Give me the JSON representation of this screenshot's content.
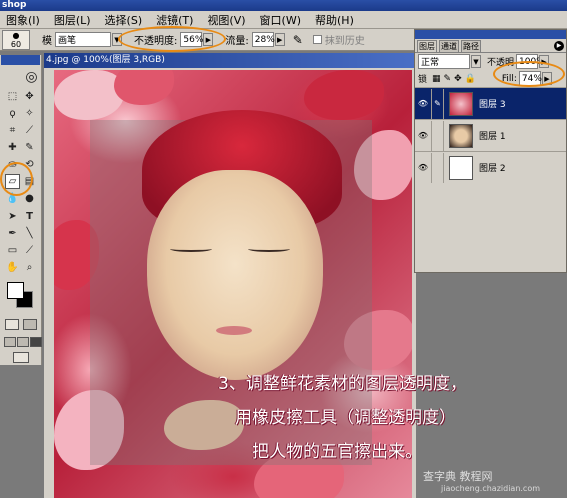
{
  "app": {
    "title": "shop"
  },
  "menu": [
    "图象(I)",
    "图层(L)",
    "选择(S)",
    "滤镜(T)",
    "视图(V)",
    "窗口(W)",
    "帮助(H)"
  ],
  "options": {
    "preset_size": "60",
    "mode_label": "模",
    "mode_value": "画笔",
    "opacity_label": "不透明度:",
    "opacity_value": "56%",
    "flow_label": "流量:",
    "flow_value": "28%",
    "erase_history_label": "抹到历史"
  },
  "document": {
    "title": "4.jpg @ 100%(图层 3,RGB)",
    "caption_lines": [
      "3、调整鲜花素材的图层透明度，",
      "用橡皮擦工具（调整透明度）",
      "把人物的五官擦出来。"
    ],
    "watermark": "查字典 教程网",
    "watermark_url": "jiaocheng.chazidian.com"
  },
  "layers_palette": {
    "tabs": [
      "图层",
      "通道",
      "路径"
    ],
    "blend_mode": "正常",
    "opacity_label": "不透明",
    "opacity_value": "100%",
    "lock_label": "锁",
    "fill_label": "Fill:",
    "fill_value": "74%",
    "layers": [
      {
        "name": "图层 3",
        "selected": true
      },
      {
        "name": "图层 1",
        "selected": false
      },
      {
        "name": "图层 2",
        "selected": false
      }
    ]
  },
  "colors": {
    "highlight": "#e88a14",
    "selection": "#0a246a",
    "chrome": "#d4d0c8"
  }
}
